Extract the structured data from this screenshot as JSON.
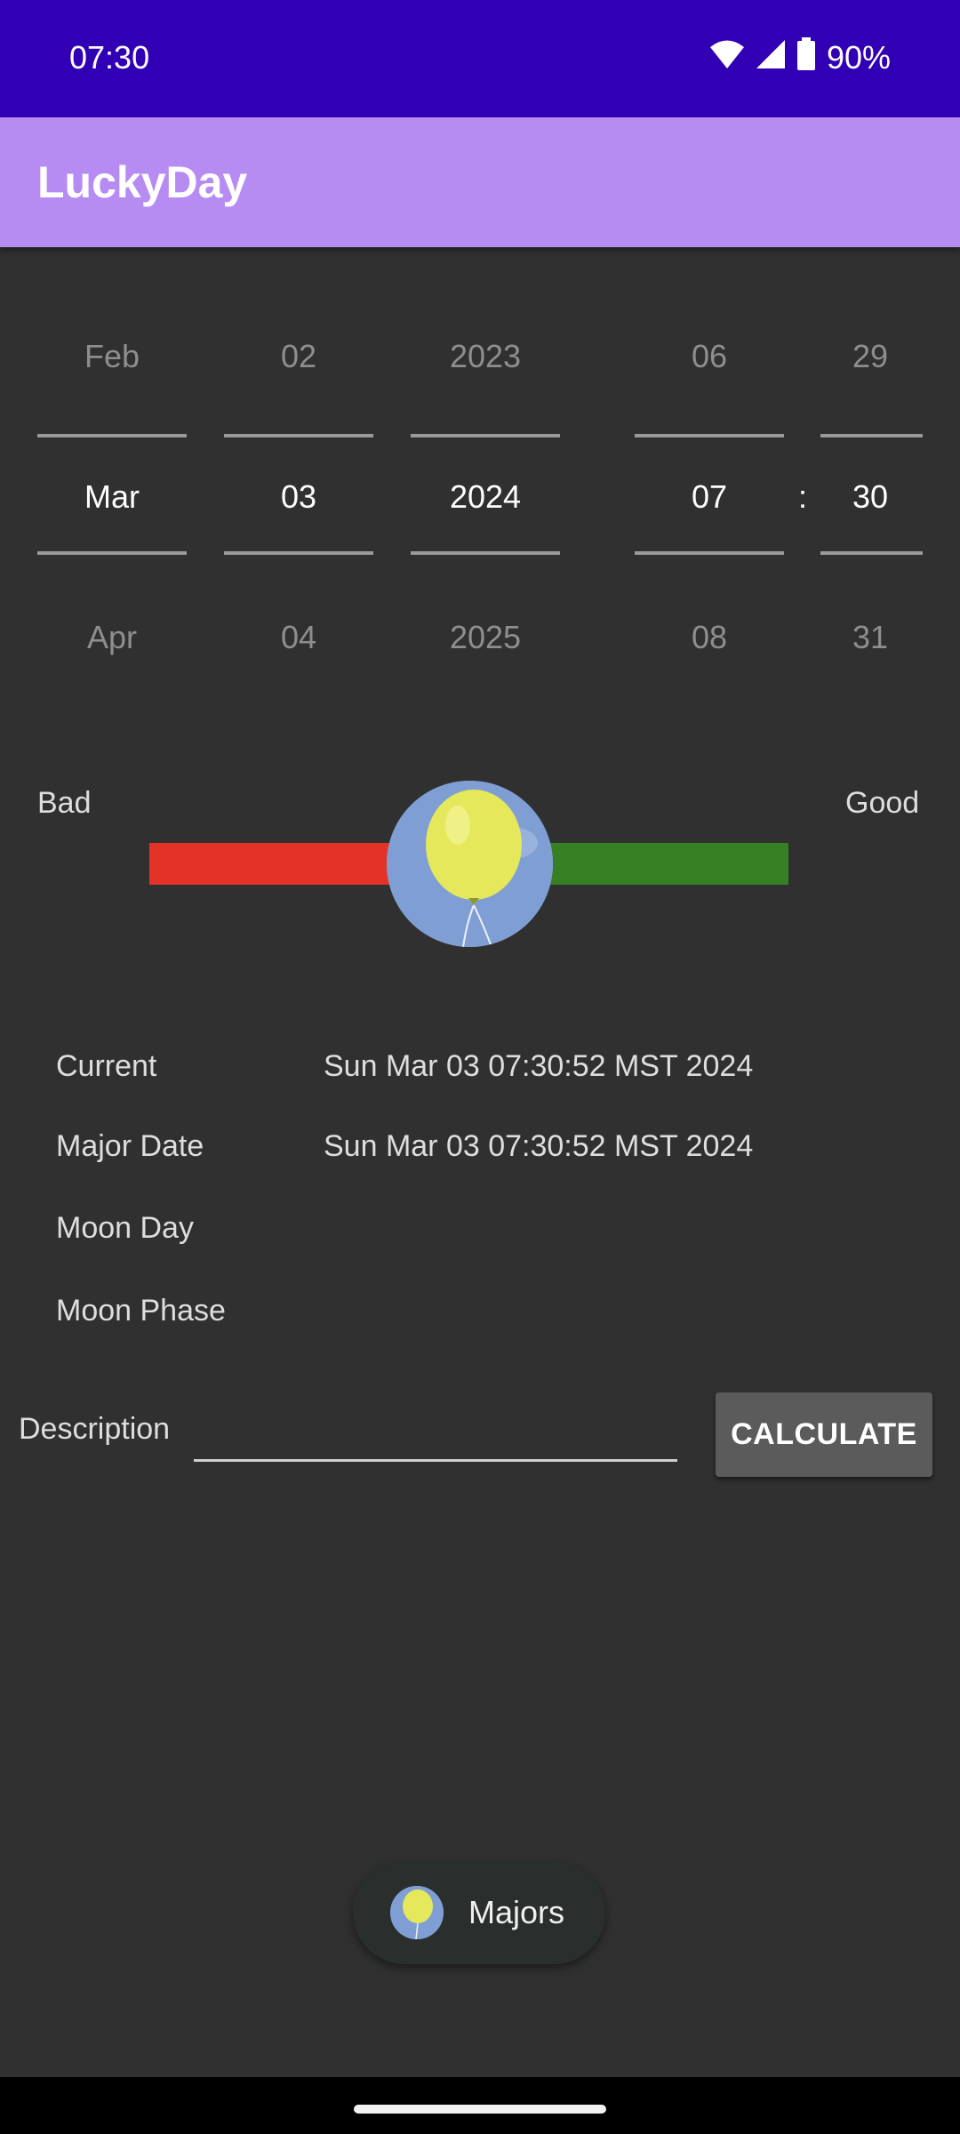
{
  "status_bar": {
    "time": "07:30",
    "battery_percent": "90%",
    "icons": [
      "wifi-icon",
      "signal-icon",
      "battery-icon"
    ]
  },
  "app_bar": {
    "title": "LuckyDay"
  },
  "picker": {
    "month": {
      "prev": "Feb",
      "selected": "Mar",
      "next": "Apr"
    },
    "day": {
      "prev": "02",
      "selected": "03",
      "next": "04"
    },
    "year": {
      "prev": "2023",
      "selected": "2024",
      "next": "2025"
    },
    "hour": {
      "prev": "06",
      "selected": "07",
      "next": "08"
    },
    "separator": ":",
    "minute": {
      "prev": "29",
      "selected": "30",
      "next": "31"
    }
  },
  "luck_slider": {
    "bad_label": "Bad",
    "good_label": "Good",
    "value_fraction": 0.5,
    "thumb_icon": "balloon-icon",
    "bad_color": "#e53228",
    "good_color": "#367f22"
  },
  "info": {
    "current_label": "Current",
    "current_value": "Sun Mar 03 07:30:52 MST 2024",
    "major_date_label": "Major Date",
    "major_date_value": "Sun Mar 03 07:30:52 MST 2024",
    "moon_day_label": "Moon Day",
    "moon_day_value": "",
    "moon_phase_label": "Moon Phase",
    "moon_phase_value": ""
  },
  "description": {
    "label": "Description",
    "value": "",
    "placeholder": ""
  },
  "calculate_button": {
    "label": "CALCULATE"
  },
  "fab": {
    "label": "Majors",
    "icon": "balloon-icon"
  },
  "colors": {
    "status_bar": "#3200b4",
    "app_bar": "#b68cf3",
    "background": "#303030"
  }
}
